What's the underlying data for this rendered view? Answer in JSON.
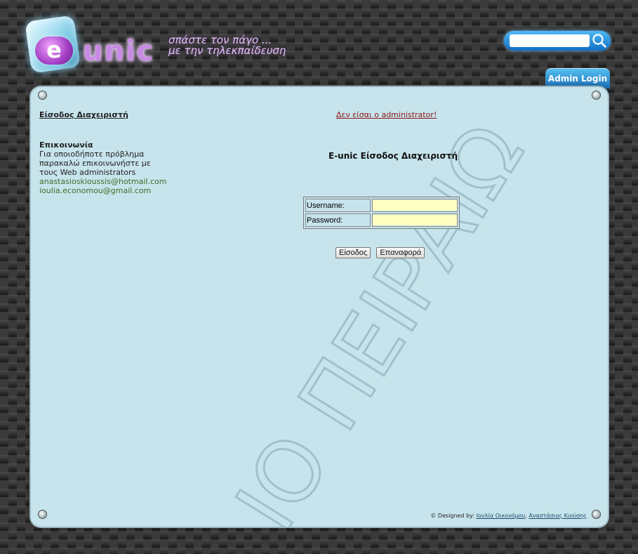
{
  "header": {
    "logo_e": "e",
    "logo_unic": "unic",
    "slogan_line1": "σπάστε τον πάγο ...",
    "slogan_line2": "με την τηλεκπαίδευση",
    "search": {
      "placeholder": "",
      "value": "",
      "icon": "search-icon"
    },
    "admin_tab_label": "Admin Login"
  },
  "sidebar": {
    "admin_link": "Είσοδος Διαχειριστή",
    "contact_title": "Επικοινωνία",
    "contact_text_1": "Για οποιοδήποτε πρόβλημα",
    "contact_text_2": "παρακαλώ επικοινωνήστε με",
    "contact_text_3": "τους Web administrators",
    "email_1": "anastasioskioussis@hotmail.com",
    "email_2": "ioulia.economou@gmail.com"
  },
  "main": {
    "not_admin_link": "Δεν είσαι ο administrator!",
    "form_title": "E-unic Είσοδος Διαχειριστή",
    "username_label": "Username:",
    "password_label": "Password:",
    "username_value": "",
    "password_value": "",
    "submit_label": "Είσοδος",
    "reset_label": "Επαναφορά"
  },
  "footer": {
    "designed_by": "© Designed by: ",
    "author_1": "Ιουλία Οικονόμου",
    "separator": ", ",
    "author_2": "Αναστάσιος Κιούσης"
  },
  "watermark": {
    "text": "ΙΟ ΠΕΙΡΑΙΩ"
  },
  "colors": {
    "panel_bg": "#c7e4ec",
    "input_bg": "#ffffc2",
    "link_red": "#8b1a1a",
    "email_green": "#3e6b26",
    "tab_blue": "#1b6fb8"
  }
}
